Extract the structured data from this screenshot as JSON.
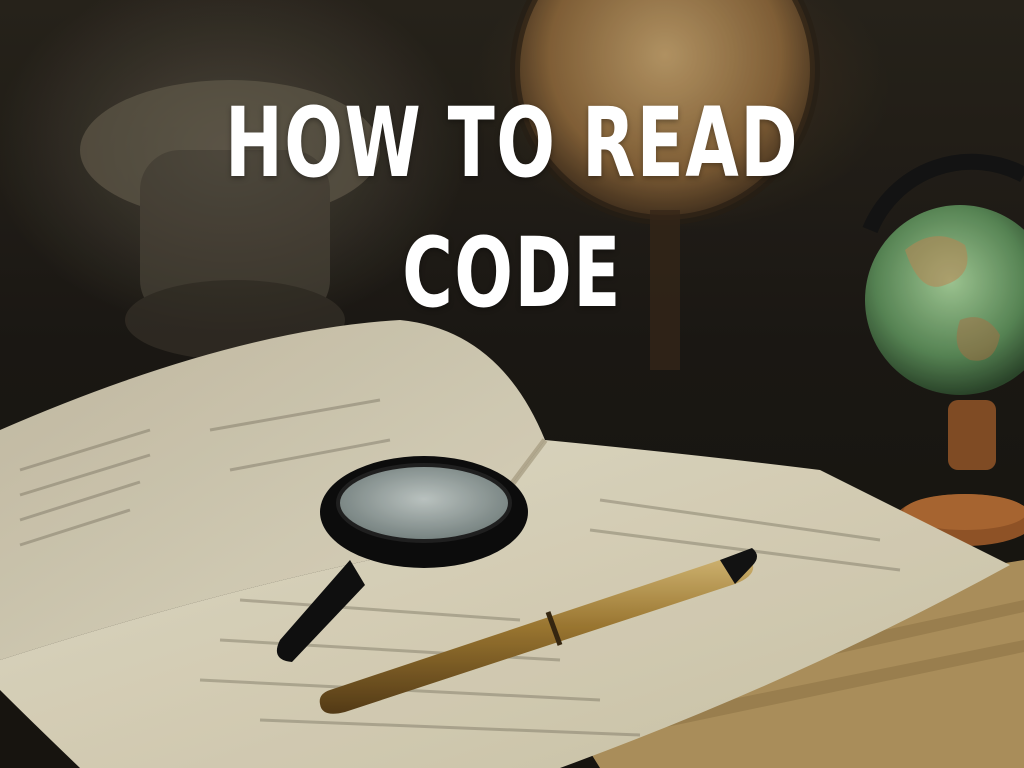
{
  "slide": {
    "title": "HOW TO READ CODE"
  },
  "colors": {
    "title_text": "#ffffff",
    "background_dark": "#1b1813",
    "page_paper": "#e9e1c8",
    "pen_gold": "#a9853a",
    "globe_green": "#6fa06a"
  }
}
